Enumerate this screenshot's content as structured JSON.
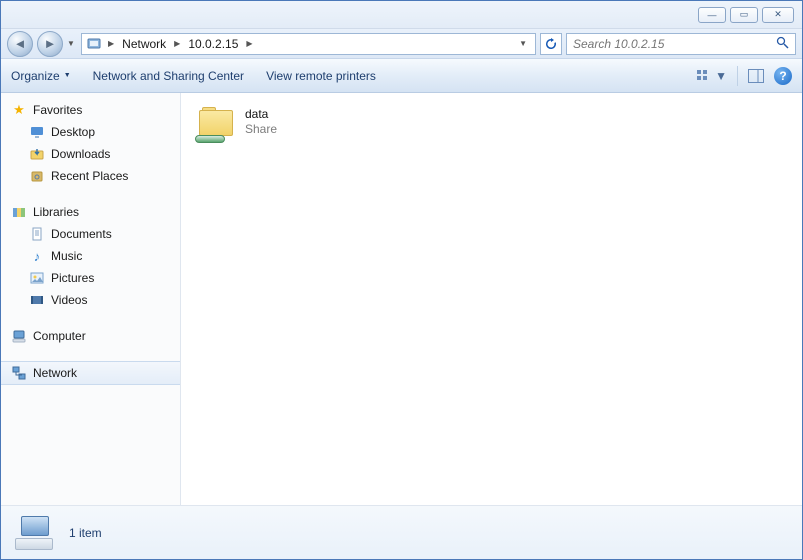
{
  "breadcrumb": {
    "parts": [
      "Network",
      "10.0.2.15"
    ]
  },
  "search": {
    "placeholder": "Search 10.0.2.15"
  },
  "commandbar": {
    "organize": "Organize",
    "sharing": "Network and Sharing Center",
    "remote": "View remote printers"
  },
  "sidebar": {
    "favorites": {
      "label": "Favorites"
    },
    "desktop": {
      "label": "Desktop"
    },
    "downloads": {
      "label": "Downloads"
    },
    "recent": {
      "label": "Recent Places"
    },
    "libraries": {
      "label": "Libraries"
    },
    "documents": {
      "label": "Documents"
    },
    "music": {
      "label": "Music"
    },
    "pictures": {
      "label": "Pictures"
    },
    "videos": {
      "label": "Videos"
    },
    "computer": {
      "label": "Computer"
    },
    "network": {
      "label": "Network"
    }
  },
  "content": {
    "items": [
      {
        "name": "data",
        "subtitle": "Share"
      }
    ]
  },
  "status": {
    "text": "1 item"
  }
}
